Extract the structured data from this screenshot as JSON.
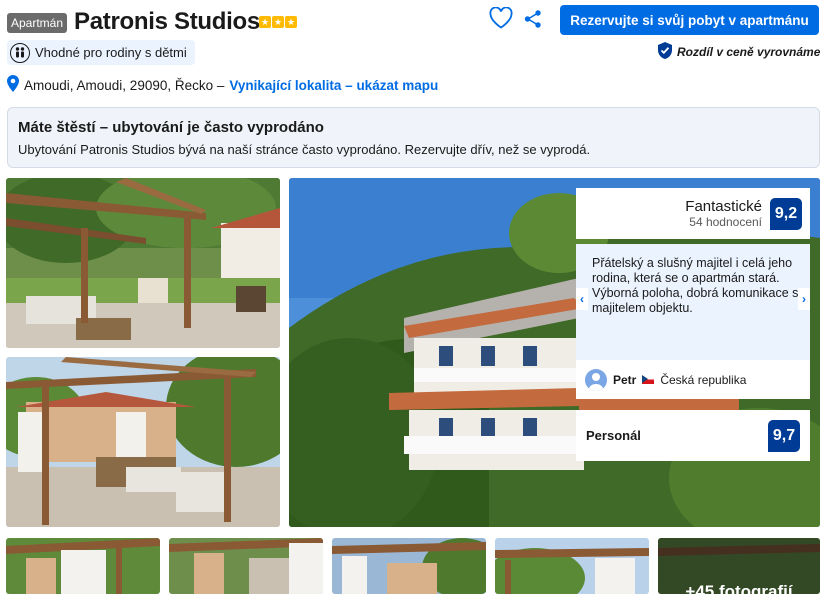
{
  "header": {
    "type_badge": "Apartmán",
    "title": "Patronis Studios",
    "stars": 3,
    "family_badge": "Vhodné pro rodiny s dětmi",
    "address": "Amoudi, Amoudi, 29090, Řecko –",
    "location_link": "Vynikající lokalita – ukázat mapu",
    "reserve_button": "Rezervujte si svůj pobyt v apartmánu",
    "price_match": "Rozdíl v ceně vyrovnáme"
  },
  "alert": {
    "title": "Máte štěstí – ubytování je často vyprodáno",
    "text": "Ubytování Patronis Studios bývá na naší stránce často vyprodáno. Rezervujte dřív, než se vyprodá."
  },
  "review": {
    "score_word": "Fantastické",
    "review_count": "54 hodnocení",
    "score": "9,2",
    "text": "Přátelský a slušný majitel i celá jeho rodina, která se o apartmán stará. Výborná poloha, dobrá komunikace s majitelem objektu.",
    "reviewer_name": "Petr",
    "reviewer_country": "Česká republika",
    "staff_label": "Personál",
    "staff_score": "9,7"
  },
  "gallery": {
    "more_photos": "+45 fotografií"
  },
  "colors": {
    "brand_blue": "#006ce4",
    "score_navy": "#003b95",
    "star_yellow": "#febb02"
  }
}
